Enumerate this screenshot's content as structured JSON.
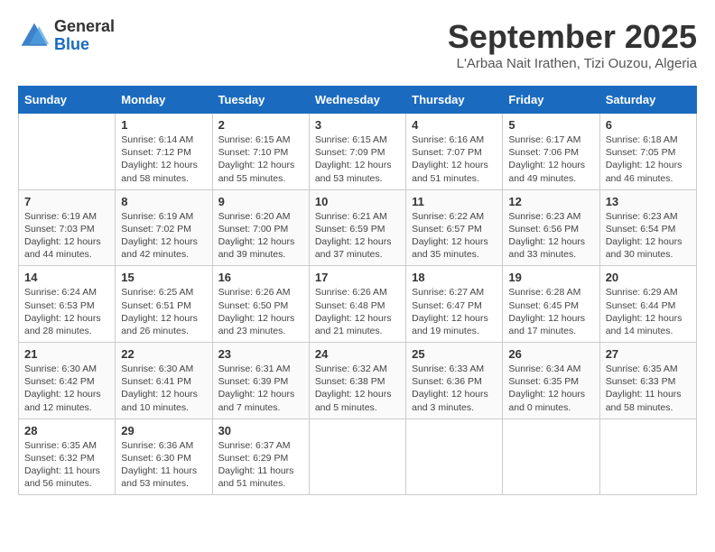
{
  "logo": {
    "general": "General",
    "blue": "Blue"
  },
  "header": {
    "month": "September 2025",
    "location": "L'Arbaa Nait Irathen, Tizi Ouzou, Algeria"
  },
  "weekdays": [
    "Sunday",
    "Monday",
    "Tuesday",
    "Wednesday",
    "Thursday",
    "Friday",
    "Saturday"
  ],
  "weeks": [
    [
      {
        "day": "",
        "sunrise": "",
        "sunset": "",
        "daylight": ""
      },
      {
        "day": "1",
        "sunrise": "Sunrise: 6:14 AM",
        "sunset": "Sunset: 7:12 PM",
        "daylight": "Daylight: 12 hours and 58 minutes."
      },
      {
        "day": "2",
        "sunrise": "Sunrise: 6:15 AM",
        "sunset": "Sunset: 7:10 PM",
        "daylight": "Daylight: 12 hours and 55 minutes."
      },
      {
        "day": "3",
        "sunrise": "Sunrise: 6:15 AM",
        "sunset": "Sunset: 7:09 PM",
        "daylight": "Daylight: 12 hours and 53 minutes."
      },
      {
        "day": "4",
        "sunrise": "Sunrise: 6:16 AM",
        "sunset": "Sunset: 7:07 PM",
        "daylight": "Daylight: 12 hours and 51 minutes."
      },
      {
        "day": "5",
        "sunrise": "Sunrise: 6:17 AM",
        "sunset": "Sunset: 7:06 PM",
        "daylight": "Daylight: 12 hours and 49 minutes."
      },
      {
        "day": "6",
        "sunrise": "Sunrise: 6:18 AM",
        "sunset": "Sunset: 7:05 PM",
        "daylight": "Daylight: 12 hours and 46 minutes."
      }
    ],
    [
      {
        "day": "7",
        "sunrise": "Sunrise: 6:19 AM",
        "sunset": "Sunset: 7:03 PM",
        "daylight": "Daylight: 12 hours and 44 minutes."
      },
      {
        "day": "8",
        "sunrise": "Sunrise: 6:19 AM",
        "sunset": "Sunset: 7:02 PM",
        "daylight": "Daylight: 12 hours and 42 minutes."
      },
      {
        "day": "9",
        "sunrise": "Sunrise: 6:20 AM",
        "sunset": "Sunset: 7:00 PM",
        "daylight": "Daylight: 12 hours and 39 minutes."
      },
      {
        "day": "10",
        "sunrise": "Sunrise: 6:21 AM",
        "sunset": "Sunset: 6:59 PM",
        "daylight": "Daylight: 12 hours and 37 minutes."
      },
      {
        "day": "11",
        "sunrise": "Sunrise: 6:22 AM",
        "sunset": "Sunset: 6:57 PM",
        "daylight": "Daylight: 12 hours and 35 minutes."
      },
      {
        "day": "12",
        "sunrise": "Sunrise: 6:23 AM",
        "sunset": "Sunset: 6:56 PM",
        "daylight": "Daylight: 12 hours and 33 minutes."
      },
      {
        "day": "13",
        "sunrise": "Sunrise: 6:23 AM",
        "sunset": "Sunset: 6:54 PM",
        "daylight": "Daylight: 12 hours and 30 minutes."
      }
    ],
    [
      {
        "day": "14",
        "sunrise": "Sunrise: 6:24 AM",
        "sunset": "Sunset: 6:53 PM",
        "daylight": "Daylight: 12 hours and 28 minutes."
      },
      {
        "day": "15",
        "sunrise": "Sunrise: 6:25 AM",
        "sunset": "Sunset: 6:51 PM",
        "daylight": "Daylight: 12 hours and 26 minutes."
      },
      {
        "day": "16",
        "sunrise": "Sunrise: 6:26 AM",
        "sunset": "Sunset: 6:50 PM",
        "daylight": "Daylight: 12 hours and 23 minutes."
      },
      {
        "day": "17",
        "sunrise": "Sunrise: 6:26 AM",
        "sunset": "Sunset: 6:48 PM",
        "daylight": "Daylight: 12 hours and 21 minutes."
      },
      {
        "day": "18",
        "sunrise": "Sunrise: 6:27 AM",
        "sunset": "Sunset: 6:47 PM",
        "daylight": "Daylight: 12 hours and 19 minutes."
      },
      {
        "day": "19",
        "sunrise": "Sunrise: 6:28 AM",
        "sunset": "Sunset: 6:45 PM",
        "daylight": "Daylight: 12 hours and 17 minutes."
      },
      {
        "day": "20",
        "sunrise": "Sunrise: 6:29 AM",
        "sunset": "Sunset: 6:44 PM",
        "daylight": "Daylight: 12 hours and 14 minutes."
      }
    ],
    [
      {
        "day": "21",
        "sunrise": "Sunrise: 6:30 AM",
        "sunset": "Sunset: 6:42 PM",
        "daylight": "Daylight: 12 hours and 12 minutes."
      },
      {
        "day": "22",
        "sunrise": "Sunrise: 6:30 AM",
        "sunset": "Sunset: 6:41 PM",
        "daylight": "Daylight: 12 hours and 10 minutes."
      },
      {
        "day": "23",
        "sunrise": "Sunrise: 6:31 AM",
        "sunset": "Sunset: 6:39 PM",
        "daylight": "Daylight: 12 hours and 7 minutes."
      },
      {
        "day": "24",
        "sunrise": "Sunrise: 6:32 AM",
        "sunset": "Sunset: 6:38 PM",
        "daylight": "Daylight: 12 hours and 5 minutes."
      },
      {
        "day": "25",
        "sunrise": "Sunrise: 6:33 AM",
        "sunset": "Sunset: 6:36 PM",
        "daylight": "Daylight: 12 hours and 3 minutes."
      },
      {
        "day": "26",
        "sunrise": "Sunrise: 6:34 AM",
        "sunset": "Sunset: 6:35 PM",
        "daylight": "Daylight: 12 hours and 0 minutes."
      },
      {
        "day": "27",
        "sunrise": "Sunrise: 6:35 AM",
        "sunset": "Sunset: 6:33 PM",
        "daylight": "Daylight: 11 hours and 58 minutes."
      }
    ],
    [
      {
        "day": "28",
        "sunrise": "Sunrise: 6:35 AM",
        "sunset": "Sunset: 6:32 PM",
        "daylight": "Daylight: 11 hours and 56 minutes."
      },
      {
        "day": "29",
        "sunrise": "Sunrise: 6:36 AM",
        "sunset": "Sunset: 6:30 PM",
        "daylight": "Daylight: 11 hours and 53 minutes."
      },
      {
        "day": "30",
        "sunrise": "Sunrise: 6:37 AM",
        "sunset": "Sunset: 6:29 PM",
        "daylight": "Daylight: 11 hours and 51 minutes."
      },
      {
        "day": "",
        "sunrise": "",
        "sunset": "",
        "daylight": ""
      },
      {
        "day": "",
        "sunrise": "",
        "sunset": "",
        "daylight": ""
      },
      {
        "day": "",
        "sunrise": "",
        "sunset": "",
        "daylight": ""
      },
      {
        "day": "",
        "sunrise": "",
        "sunset": "",
        "daylight": ""
      }
    ]
  ]
}
